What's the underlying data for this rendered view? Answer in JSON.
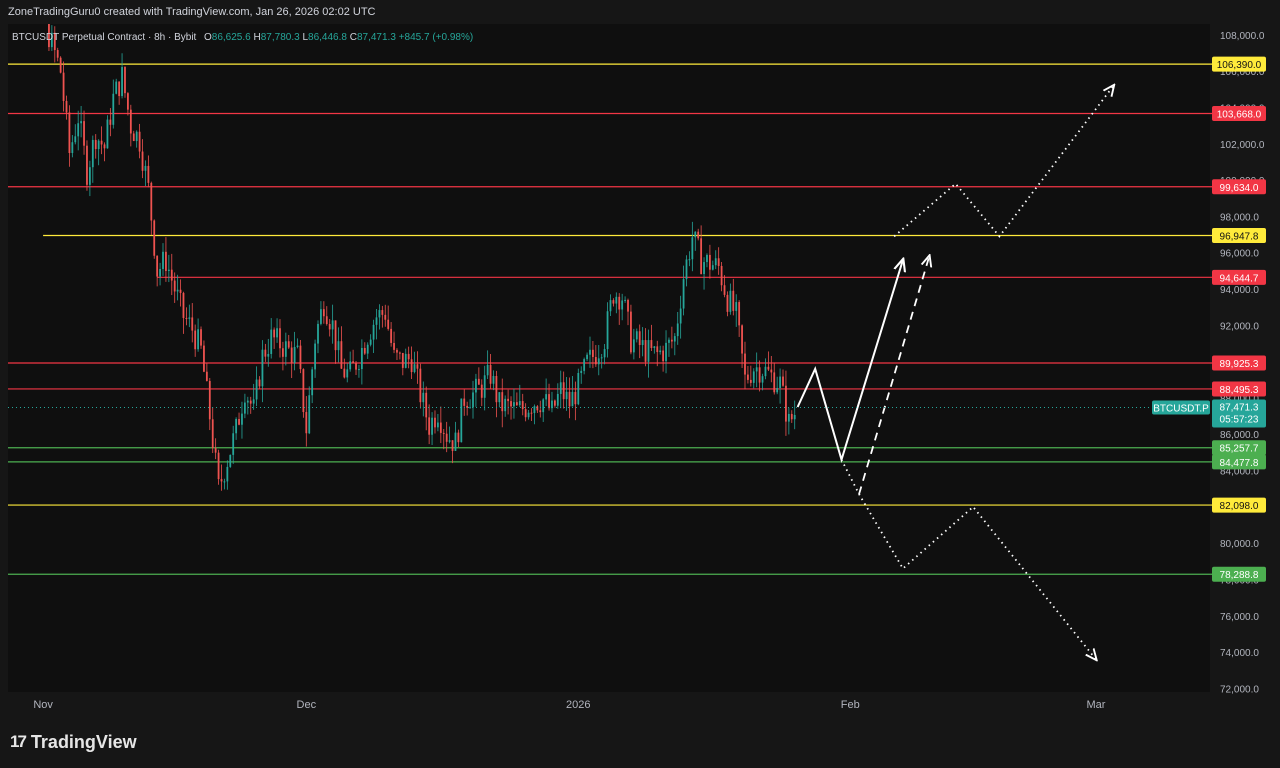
{
  "header": {
    "attribution": "ZoneTradingGuru0 created with TradingView.com, Jan 26, 2026 02:02 UTC"
  },
  "legend": {
    "symbol": "BTCUSDT Perpetual Contract · 8h · Bybit",
    "o_label": "O",
    "o": "86,625.6",
    "h_label": "H",
    "h": "87,780.3",
    "l_label": "L",
    "l": "86,446.8",
    "c_label": "C",
    "c": "87,471.3",
    "change": "+845.7 (+0.98%)"
  },
  "footer": {
    "logo_mark": "17",
    "logo_text": "TradingView"
  },
  "colors": {
    "background": "#0f0f0f",
    "up": "#26a69a",
    "down": "#ef5350",
    "yellow": "#ffeb3b",
    "red": "#f23645",
    "green": "#4caf50",
    "axis_text": "#b2b5be"
  },
  "chart_data": {
    "type": "candlestick",
    "timeframe": "8h",
    "y_axis": {
      "range": [
        71800,
        108600
      ],
      "ticks": [
        108000,
        106000,
        104000,
        102000,
        100000,
        98000,
        96000,
        94000,
        92000,
        90000,
        88000,
        86000,
        84000,
        82000,
        80000,
        78000,
        76000,
        74000,
        72000
      ],
      "tick_labels": [
        "108,000.0",
        "106,000.0",
        "104,000.0",
        "102,000.0",
        "100,000.0",
        "98,000.0",
        "96,000.0",
        "94,000.0",
        "92,000.0",
        "90,000.0",
        "88,000.0",
        "86,000.0",
        "84,000.0",
        "82,000.0",
        "80,000.0",
        "78,000.0",
        "76,000.0",
        "74,000.0",
        "72,000.0"
      ]
    },
    "x_axis": {
      "range": [
        "2025-10-28",
        "2026-03-14"
      ],
      "ticks": [
        {
          "date": "2025-11-01",
          "label": "Nov"
        },
        {
          "date": "2025-12-01",
          "label": "Dec"
        },
        {
          "date": "2026-01-01",
          "label": "2026"
        },
        {
          "date": "2026-02-01",
          "label": "Feb"
        },
        {
          "date": "2026-03-01",
          "label": "Mar"
        }
      ]
    },
    "levels": [
      {
        "price": 106390.0,
        "label": "106,390.0",
        "color": "yellow",
        "from": "2025-10-28"
      },
      {
        "price": 103668.0,
        "label": "103,668.0",
        "color": "red",
        "from": "2025-10-28"
      },
      {
        "price": 99634.0,
        "label": "99,634.0",
        "color": "red",
        "from": "2025-10-28"
      },
      {
        "price": 96947.8,
        "label": "96,947.8",
        "color": "yellow",
        "from": "2025-11-01"
      },
      {
        "price": 94644.7,
        "label": "94,644.7",
        "color": "red",
        "from": "2025-11-14"
      },
      {
        "price": 89925.3,
        "label": "89,925.3",
        "color": "red",
        "from": "2025-10-28"
      },
      {
        "price": 88495.3,
        "label": "88,495.3",
        "color": "red",
        "from": "2025-10-28"
      },
      {
        "price": 85257.7,
        "label": "85,257.7",
        "color": "green",
        "from": "2025-10-28"
      },
      {
        "price": 84477.8,
        "label": "84,477.8",
        "color": "green",
        "from": "2025-10-28"
      },
      {
        "price": 82098.0,
        "label": "82,098.0",
        "color": "yellow",
        "from": "2025-10-28"
      },
      {
        "price": 78288.8,
        "label": "78,288.8",
        "color": "green",
        "from": "2025-10-28"
      }
    ],
    "last_price": {
      "symbol_label": "BTCUSDT.P",
      "price": 87471.3,
      "price_label": "87,471.3",
      "countdown": "05:57:23"
    },
    "price_path_close": [
      [
        "2025-10-28",
        111500
      ],
      [
        "2025-10-31",
        110500
      ],
      [
        "2025-11-03",
        106000
      ],
      [
        "2025-11-04",
        101500
      ],
      [
        "2025-11-05",
        103500
      ],
      [
        "2025-11-06",
        100500
      ],
      [
        "2025-11-07",
        102500
      ],
      [
        "2025-11-08",
        101800
      ],
      [
        "2025-11-09",
        104500
      ],
      [
        "2025-11-10",
        105700
      ],
      [
        "2025-11-11",
        103000
      ],
      [
        "2025-11-12",
        102200
      ],
      [
        "2025-11-13",
        99500
      ],
      [
        "2025-11-14",
        95000
      ],
      [
        "2025-11-15",
        95600
      ],
      [
        "2025-11-16",
        94000
      ],
      [
        "2025-11-17",
        92500
      ],
      [
        "2025-11-18",
        91800
      ],
      [
        "2025-11-19",
        90600
      ],
      [
        "2025-11-20",
        87000
      ],
      [
        "2025-11-21",
        83000
      ],
      [
        "2025-11-22",
        84600
      ],
      [
        "2025-11-23",
        86200
      ],
      [
        "2025-11-24",
        88500
      ],
      [
        "2025-11-25",
        87300
      ],
      [
        "2025-11-26",
        90300
      ],
      [
        "2025-11-27",
        91300
      ],
      [
        "2025-11-28",
        91000
      ],
      [
        "2025-11-29",
        90600
      ],
      [
        "2025-11-30",
        90300
      ],
      [
        "2025-12-01",
        86300
      ],
      [
        "2025-12-02",
        91300
      ],
      [
        "2025-12-03",
        93300
      ],
      [
        "2025-12-04",
        92000
      ],
      [
        "2025-12-05",
        89500
      ],
      [
        "2025-12-06",
        89300
      ],
      [
        "2025-12-07",
        90300
      ],
      [
        "2025-12-08",
        91500
      ],
      [
        "2025-12-09",
        92500
      ],
      [
        "2025-12-10",
        92700
      ],
      [
        "2025-12-11",
        90200
      ],
      [
        "2025-12-12",
        90000
      ],
      [
        "2025-12-13",
        90200
      ],
      [
        "2025-12-14",
        88200
      ],
      [
        "2025-12-15",
        86500
      ],
      [
        "2025-12-16",
        87300
      ],
      [
        "2025-12-17",
        86000
      ],
      [
        "2025-12-18",
        85500
      ],
      [
        "2025-12-19",
        88000
      ],
      [
        "2025-12-20",
        88200
      ],
      [
        "2025-12-21",
        88600
      ],
      [
        "2025-12-22",
        89300
      ],
      [
        "2025-12-23",
        87600
      ],
      [
        "2025-12-24",
        87500
      ],
      [
        "2025-12-25",
        87300
      ],
      [
        "2025-12-26",
        87500
      ],
      [
        "2025-12-27",
        87800
      ],
      [
        "2025-12-28",
        87900
      ],
      [
        "2025-12-29",
        87200
      ],
      [
        "2025-12-30",
        88400
      ],
      [
        "2025-12-31",
        87700
      ],
      [
        "2026-01-01",
        88600
      ],
      [
        "2026-01-02",
        89900
      ],
      [
        "2026-01-03",
        90500
      ],
      [
        "2026-01-04",
        91300
      ],
      [
        "2026-01-05",
        93800
      ],
      [
        "2026-01-06",
        93600
      ],
      [
        "2026-01-07",
        91200
      ],
      [
        "2026-01-08",
        90900
      ],
      [
        "2026-01-09",
        90500
      ],
      [
        "2026-01-10",
        90400
      ],
      [
        "2026-01-11",
        90700
      ],
      [
        "2026-01-12",
        91300
      ],
      [
        "2026-01-13",
        94700
      ],
      [
        "2026-01-14",
        96900
      ],
      [
        "2026-01-15",
        95600
      ],
      [
        "2026-01-16",
        95400
      ],
      [
        "2026-01-17",
        95200
      ],
      [
        "2026-01-18",
        93500
      ],
      [
        "2026-01-19",
        92500
      ],
      [
        "2026-01-20",
        89000
      ],
      [
        "2026-01-21",
        89700
      ],
      [
        "2026-01-22",
        89600
      ],
      [
        "2026-01-23",
        89200
      ],
      [
        "2026-01-24",
        88800
      ],
      [
        "2026-01-25",
        86600
      ],
      [
        "2026-01-26",
        87471.3
      ]
    ],
    "projections": [
      {
        "style": "solid",
        "points": [
          [
            "2026-01-26",
            87500
          ],
          [
            "2026-01-28",
            89600
          ],
          [
            "2026-01-31",
            84600
          ],
          [
            "2026-02-07",
            95600
          ]
        ]
      },
      {
        "style": "dotted",
        "points": [
          [
            "2026-01-31",
            84600
          ],
          [
            "2026-02-02",
            82700
          ],
          [
            "2026-02-07",
            78600
          ],
          [
            "2026-02-15",
            82000
          ],
          [
            "2026-03-01",
            73600
          ]
        ]
      },
      {
        "style": "dashed",
        "points": [
          [
            "2026-02-02",
            82700
          ],
          [
            "2026-02-10",
            95800
          ]
        ]
      },
      {
        "style": "dotted",
        "points": [
          [
            "2026-02-06",
            96900
          ],
          [
            "2026-02-13",
            99800
          ],
          [
            "2026-02-18",
            96900
          ],
          [
            "2026-03-03",
            105200
          ]
        ]
      }
    ]
  }
}
